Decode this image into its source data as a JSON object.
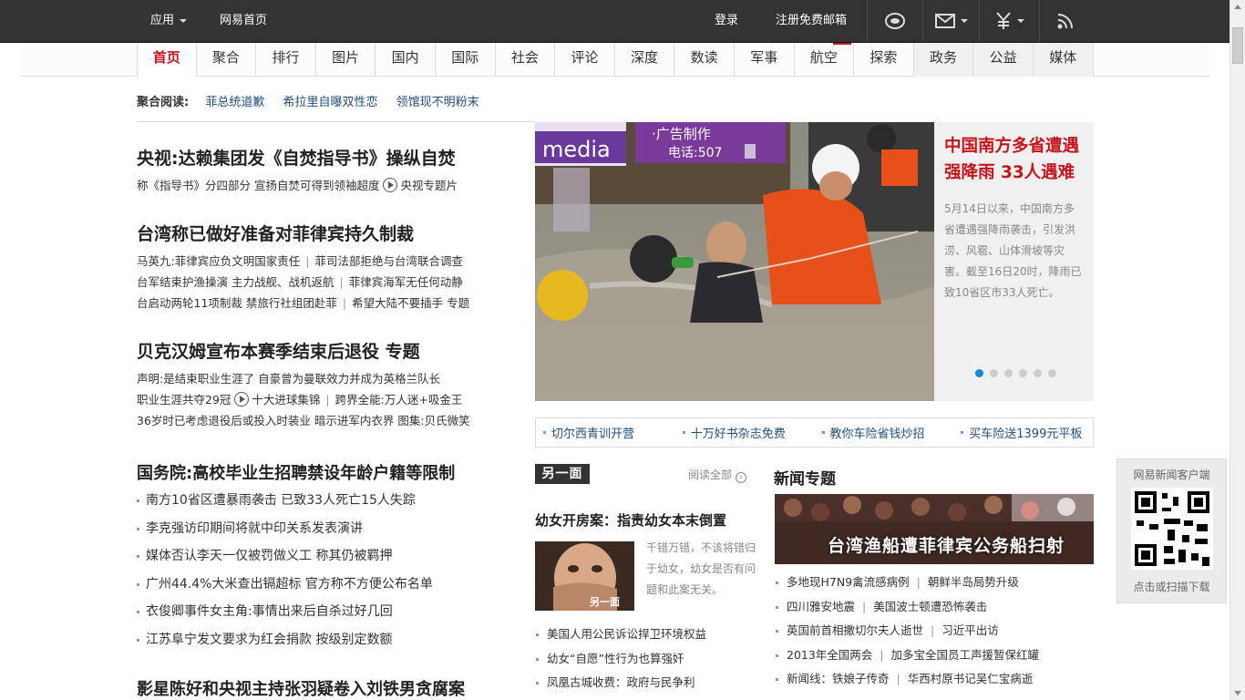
{
  "topbar": {
    "apps": "应用",
    "home": "网易首页",
    "login": "登录",
    "register": "注册免费邮箱"
  },
  "nav": {
    "tabs": [
      "首页",
      "聚合",
      "排行",
      "图片",
      "国内",
      "国际",
      "社会",
      "评论",
      "深度",
      "数读",
      "军事",
      "航空",
      "探索",
      "政务",
      "公益",
      "媒体"
    ]
  },
  "agg": {
    "label": "聚合阅读:",
    "links": [
      "菲总统道歉",
      "希拉里自曝双性恋",
      "领馆现不明粉末"
    ]
  },
  "left": {
    "h1": "央视:达赖集团发《自焚指导书》操纵自焚",
    "h1_sub_a": "称《指导书》分四部分 宣扬自焚可得到领袖超度",
    "h1_sub_b": "央视专题片",
    "h2": "台湾称已做好准备对菲律宾持久制裁",
    "h2_lines": [
      [
        "马英九:菲律宾应负文明国家责任",
        "菲司法部拒绝与台湾联合调查"
      ],
      [
        "台军结束护渔操演 主力战舰、战机返航",
        "菲律宾海军无任何动静"
      ],
      [
        "台启动两轮11项制裁 禁旅行社组团赴菲",
        "希望大陆不要插手 专题"
      ]
    ],
    "h3": "贝克汉姆宣布本赛季结束后退役 专题",
    "h3_line1": "声明:是结束职业生涯了 自豪曾为曼联效力并成为英格兰队长",
    "h3_line2_a": "职业生涯共夺29冠",
    "h3_line2_b": "十大进球集锦",
    "h3_line2_c": "跨界全能:万人迷+吸金王",
    "h3_line3": "36岁时已考虑退役后或投入时装业 暗示进军内衣界 图集:贝氏微笑",
    "h4": "国务院:高校毕业生招聘禁设年龄户籍等限制",
    "list": [
      "南方10省区遭暴雨袭击 已致33人死亡15人失踪",
      "李克强访印期间将就中印关系发表演讲",
      "媒体否认李天一仅被罚做义工 称其仍被羁押",
      "广州44.4%大米查出镉超标 官方称不方便公布名单",
      "衣俊卿事件女主角:事情出来后自杀过好几回",
      "江苏阜宁发文要求为红会捐款 按级别定数额"
    ],
    "h5": "影星陈好和央视主持张羽疑卷入刘铁男贪腐案"
  },
  "feature": {
    "sign_media": "media",
    "sign_ad": "·广告制作",
    "sign_phone": "电话:507",
    "title": "中国南方多省遭遇强降雨 33人遇难",
    "desc": "5月14日以来，中国南方多省遭遇强降雨袭击，引发洪涝、风雹、山体滑坡等灾害。截至16日20时，降雨已致10省区市33人死亡。",
    "dots": 6,
    "active_dot": 0
  },
  "ads": [
    "切尔西青训开营",
    "十万好书杂志免费",
    "教你车险省钱炒招",
    "买车险送1399元平板"
  ],
  "another_side": {
    "logo": "另一面",
    "more": "阅读全部",
    "title": "幼女开房案：指责幼女本末倒置",
    "img_caption": "另一面",
    "desc": "千错万错，不该将错归于幼女，幼女是否有问题和此案无关。",
    "list": [
      "美国人用公民诉讼捍卫环境权益",
      "幼女“自愿”性行为也算强奸",
      "凤凰古城收费：政府与民争利"
    ]
  },
  "topics": {
    "title": "新闻专题",
    "banner": "台湾渔船遭菲律宾公务船扫射",
    "list": [
      [
        "多地现H7N9禽流感病例",
        "朝鲜半岛局势升级"
      ],
      [
        "四川雅安地震",
        "美国波士顿遭恐怖袭击"
      ],
      [
        "英国前首相撒切尔夫人逝世",
        "习近平出访"
      ],
      [
        "2013年全国两会",
        "加多宝全国员工声援暂保红罐"
      ],
      [
        "新闻线：铁娘子传奇",
        "华西村原书记吴仁宝病逝"
      ]
    ]
  },
  "qr": {
    "title": "网易新闻客户端",
    "hint": "点击或扫描下载"
  },
  "colors": {
    "accent_red": "#c4161c",
    "link_blue": "#1f4f7f",
    "topbar": "#333333",
    "dot_active": "#1a8ad0"
  }
}
